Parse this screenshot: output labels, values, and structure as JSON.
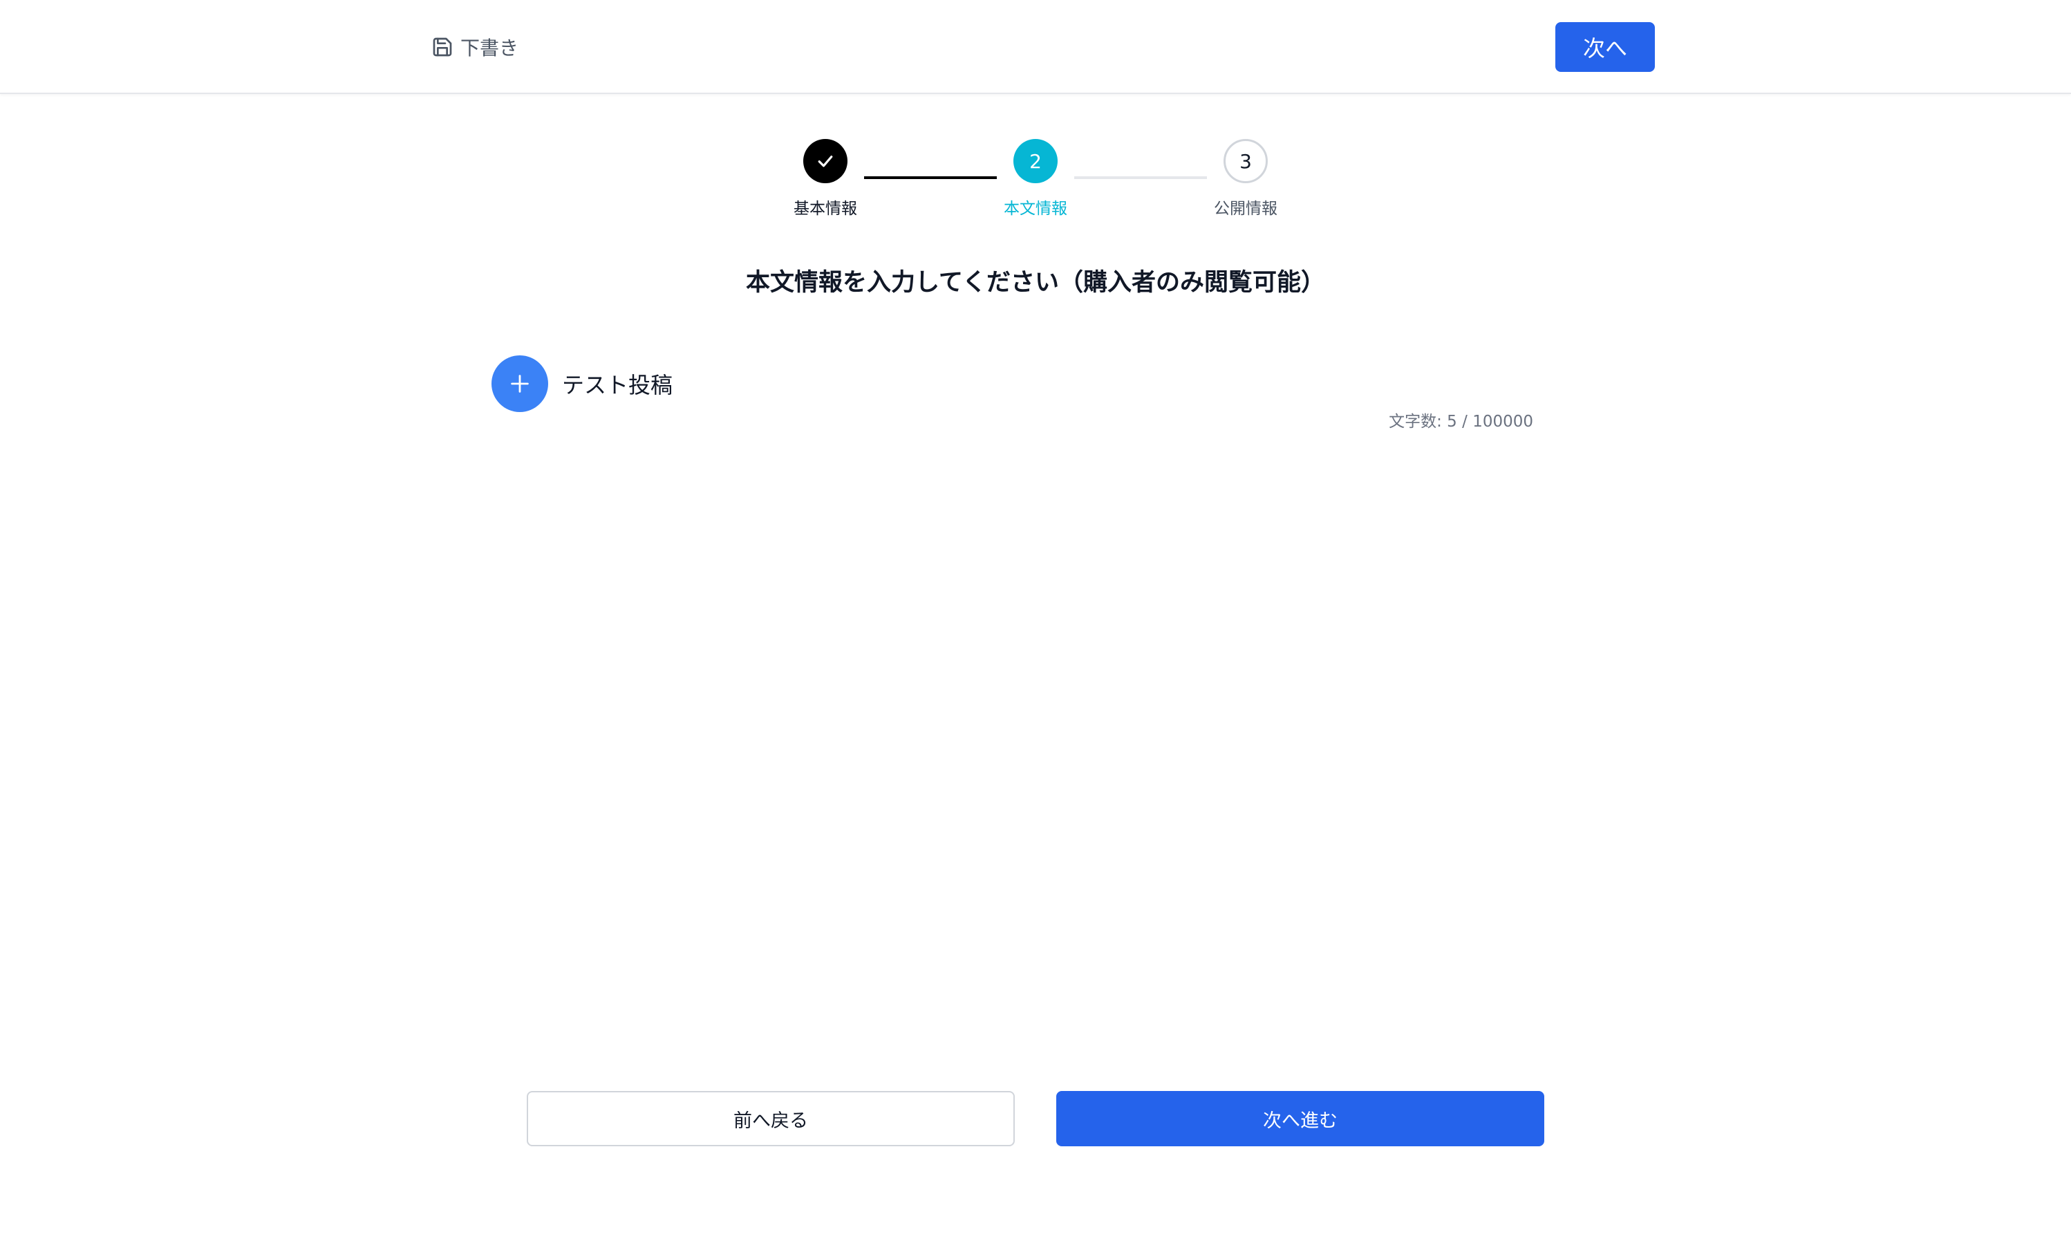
{
  "header": {
    "draft_label": "下書き",
    "next_label": "次へ"
  },
  "stepper": {
    "steps": [
      {
        "label": "基本情報",
        "status": "done",
        "number": ""
      },
      {
        "label": "本文情報",
        "status": "active",
        "number": "2"
      },
      {
        "label": "公開情報",
        "status": "todo",
        "number": "3"
      }
    ]
  },
  "main": {
    "title": "本文情報を入力してください（購入者のみ閲覧可能）",
    "editor_text": "テスト投稿",
    "char_count": "文字数: 5 / 100000"
  },
  "footer": {
    "back_label": "前へ戻る",
    "next_label": "次へ進む"
  },
  "colors": {
    "primary": "#2563eb",
    "active_step": "#06b6d4",
    "done_step": "#000000",
    "add_button": "#3b82f6"
  }
}
